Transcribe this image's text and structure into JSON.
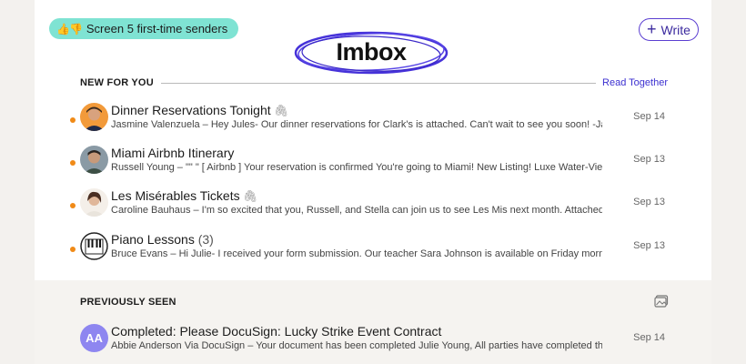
{
  "header": {
    "screen_pill_label": "Screen 5 first-time senders",
    "screen_pill_icon": "thumbs-up-down-icon",
    "write_label": "Write",
    "brand_title": "Imbox",
    "brand_accent": "#4632d9"
  },
  "new_for_you": {
    "title": "NEW FOR YOU",
    "read_together": "Read Together",
    "items": [
      {
        "subject": "Dinner Reservations Tonight",
        "has_attachment": true,
        "snippet": "Jasmine Valenzuela – Hey Jules- Our dinner reservations for Clark's is attached. Can't wait to see you soon! -Jas",
        "date": "Sep 14"
      },
      {
        "subject": "Miami Airbnb Itinerary",
        "snippet": "Russell Young – \"\" \" [ Airbnb ] Your reservation is confirmed You're going to Miami! New Listing! Luxe Water-View...",
        "date": "Sep 13"
      },
      {
        "subject": "Les Misérables Tickets",
        "has_attachment": true,
        "snippet": "Caroline Bauhaus – I'm so excited that you, Russell, and Stella can join us to see Les Mis next month. Attached are...",
        "date": "Sep 13"
      },
      {
        "subject": "Piano Lessons",
        "count": "(3)",
        "snippet": "Bruce Evans – Hi Julie- I received your form submission. Our teacher Sara Johnson is available on Friday mornin...",
        "date": "Sep 13"
      }
    ]
  },
  "previously_seen": {
    "title": "PREVIOUSLY SEEN",
    "items": [
      {
        "initials": "AA",
        "subject": "Completed: Please DocuSign: Lucky Strike Event Contract",
        "snippet": "Abbie Anderson Via DocuSign – Your document has been completed Julie Young, All parties have completed the ...",
        "date": "Sep 14"
      }
    ]
  },
  "colors": {
    "unread_dot": "#f08a17",
    "pill_bg": "#7fe3d3",
    "link": "#3b2fd0",
    "aa_avatar": "#8e86f0"
  }
}
